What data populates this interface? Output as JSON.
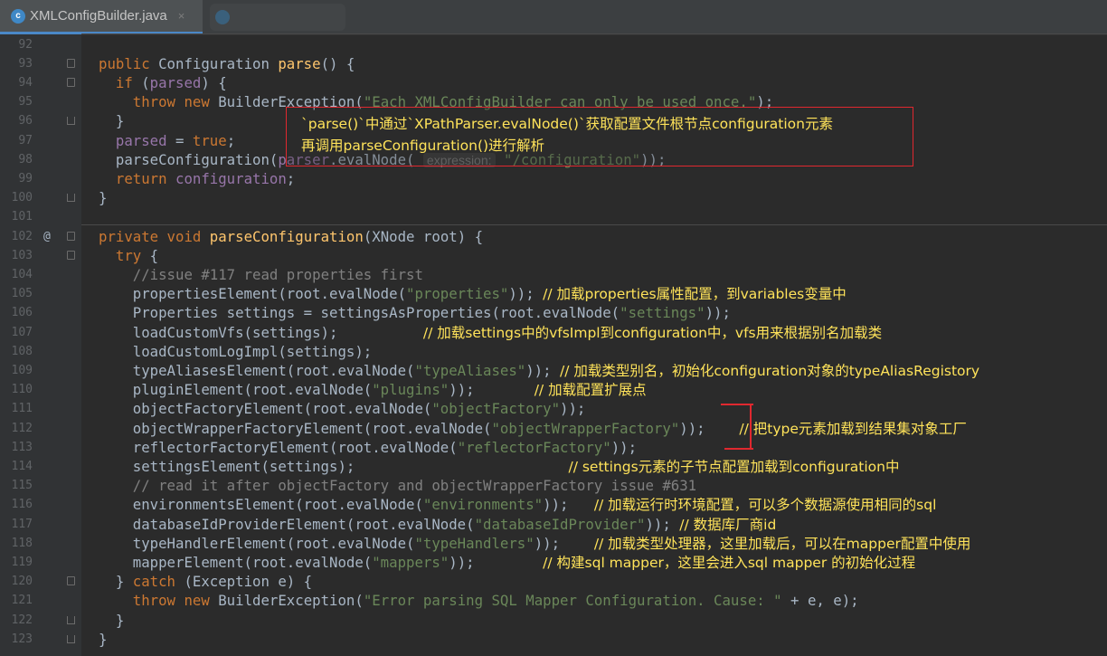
{
  "tab": {
    "icon_letter": "c",
    "label": "XMLConfigBuilder.java",
    "close": "×"
  },
  "lines": [
    {
      "n": "92",
      "html": "",
      "ann": ""
    },
    {
      "n": "93",
      "html": "<span class='k'>public</span> Configuration <span class='m'>parse</span>() {",
      "fold": "start"
    },
    {
      "n": "94",
      "html": "  <span class='k'>if</span> (<span class='f'>parsed</span>) {",
      "fold": "start"
    },
    {
      "n": "95",
      "html": "    <span class='k'>throw new</span> BuilderException(<span class='s'>\"Each XMLConfigBuilder can only be used once.\"</span>);"
    },
    {
      "n": "96",
      "html": "  }",
      "fold": "end"
    },
    {
      "n": "97",
      "html": "  <span class='f'>parsed</span> = <span class='k'>true</span>;"
    },
    {
      "n": "98",
      "html": "  parseConfiguration(<span class='f'>parser</span>.evalNode( <span class='hint'>expression:</span> <span class='s'>\"/configuration\"</span>));"
    },
    {
      "n": "99",
      "html": "  <span class='k'>return</span> <span class='f'>configuration</span>;"
    },
    {
      "n": "100",
      "html": "}",
      "fold": "end"
    },
    {
      "n": "101",
      "html": ""
    },
    {
      "n": "102",
      "html": "<span class='k'>private void</span> <span class='m'>parseConfiguration</span>(XNode root) {",
      "fold": "start",
      "ann": "@"
    },
    {
      "n": "103",
      "html": "  <span class='k'>try</span> {",
      "fold": "start"
    },
    {
      "n": "104",
      "html": "    <span class='c'>//issue #117 read properties first</span>"
    },
    {
      "n": "105",
      "html": "    propertiesElement(root.evalNode(<span class='s'>\"properties\"</span>)); <span class='z'>// 加载properties属性配置，到variables变量中</span>"
    },
    {
      "n": "106",
      "html": "    Properties settings = settingsAsProperties(root.evalNode(<span class='s'>\"settings\"</span>));"
    },
    {
      "n": "107",
      "html": "    loadCustomVfs(settings);          <span class='z'>// 加载settings中的vfsImpl到configuration中，vfs用来根据别名加载类</span>"
    },
    {
      "n": "108",
      "html": "    loadCustomLogImpl(settings);"
    },
    {
      "n": "109",
      "html": "    typeAliasesElement(root.evalNode(<span class='s'>\"typeAliases\"</span>)); <span class='z'>// 加载类型别名，初始化configuration对象的typeAliasRegistory</span>"
    },
    {
      "n": "110",
      "html": "    pluginElement(root.evalNode(<span class='s'>\"plugins\"</span>));       <span class='z'>// 加载配置扩展点</span>"
    },
    {
      "n": "111",
      "html": "    objectFactoryElement(root.evalNode(<span class='s'>\"objectFactory\"</span>));"
    },
    {
      "n": "112",
      "html": "    objectWrapperFactoryElement(root.evalNode(<span class='s'>\"objectWrapperFactory\"</span>));    <span class='z'>// 把type元素加载到结果集对象工厂</span>"
    },
    {
      "n": "113",
      "html": "    reflectorFactoryElement(root.evalNode(<span class='s'>\"reflectorFactory\"</span>));"
    },
    {
      "n": "114",
      "html": "    settingsElement(settings);                         <span class='z'>// settings元素的子节点配置加载到configuration中</span>"
    },
    {
      "n": "115",
      "html": "    <span class='c'>// read it after objectFactory and objectWrapperFactory issue #631</span>"
    },
    {
      "n": "116",
      "html": "    environmentsElement(root.evalNode(<span class='s'>\"environments\"</span>));   <span class='z'>// 加载运行时环境配置，可以多个数据源使用相同的sql</span>"
    },
    {
      "n": "117",
      "html": "    databaseIdProviderElement(root.evalNode(<span class='s'>\"databaseIdProvider\"</span>)); <span class='z'>// 数据库厂商id</span>"
    },
    {
      "n": "118",
      "html": "    typeHandlerElement(root.evalNode(<span class='s'>\"typeHandlers\"</span>));    <span class='z'>// 加载类型处理器，这里加载后，可以在mapper配置中使用</span>"
    },
    {
      "n": "119",
      "html": "    mapperElement(root.evalNode(<span class='s'>\"mappers\"</span>));        <span class='z'>// 构建sql mapper，这里会进入sql mapper 的初始化过程</span>"
    },
    {
      "n": "120",
      "html": "  } <span class='k'>catch</span> (Exception e) {",
      "fold": "start"
    },
    {
      "n": "121",
      "html": "    <span class='k'>throw new</span> BuilderException(<span class='s'>\"Error parsing SQL Mapper Configuration. Cause: \"</span> + e, e);"
    },
    {
      "n": "122",
      "html": "  }",
      "fold": "end"
    },
    {
      "n": "123",
      "html": "}",
      "fold": "end"
    }
  ],
  "callout": {
    "line1": "`parse()`中通过`XPathParser.evalNode()`获取配置文件根节点configuration元素",
    "line2": "再调用parseConfiguration()进行解析"
  },
  "colors": {
    "background": "#2b2b2b",
    "keyword": "#cc7832",
    "string": "#6a8759",
    "method": "#ffc66d",
    "field": "#9876aa",
    "comment": "#808080",
    "annotation_text": "#ffe35a",
    "callout_border": "#e0282f"
  }
}
